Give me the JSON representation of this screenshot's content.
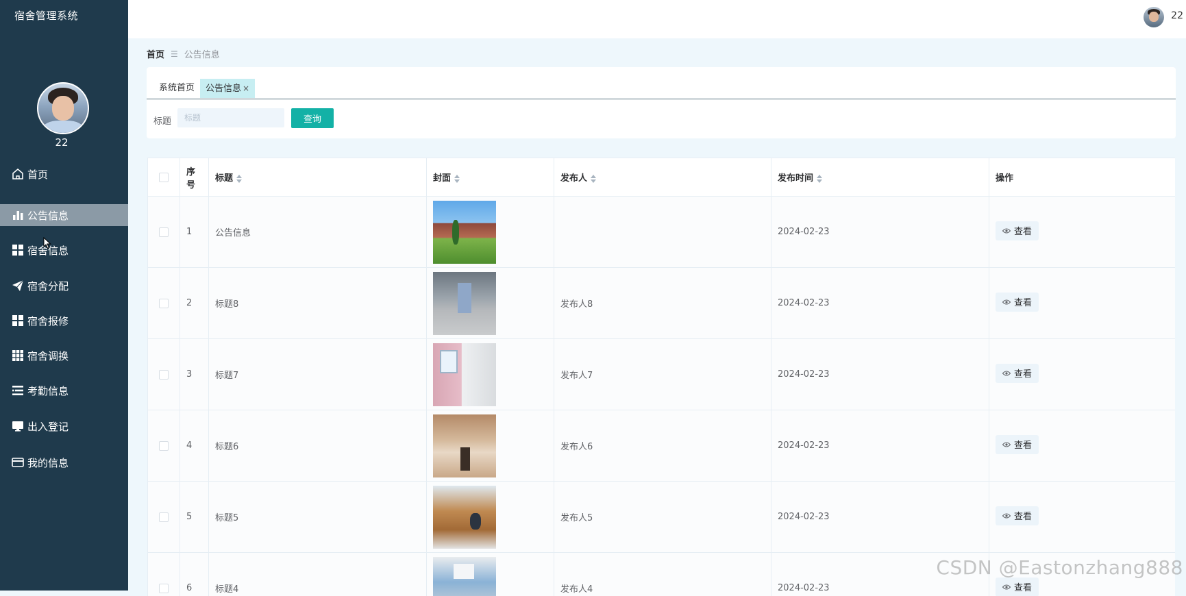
{
  "app": {
    "title": "宿舍管理系统"
  },
  "user": {
    "name": "22"
  },
  "sidebar": {
    "items": [
      {
        "label": "首页",
        "icon": "home-icon"
      },
      {
        "label": "公告信息",
        "icon": "bar-chart-icon"
      },
      {
        "label": "宿舍信息",
        "icon": "grid-icon"
      },
      {
        "label": "宿舍分配",
        "icon": "paper-plane-icon"
      },
      {
        "label": "宿舍报修",
        "icon": "grid-icon"
      },
      {
        "label": "宿舍调换",
        "icon": "apps-icon"
      },
      {
        "label": "考勤信息",
        "icon": "list-icon"
      },
      {
        "label": "出入登记",
        "icon": "monitor-icon"
      },
      {
        "label": "我的信息",
        "icon": "card-icon"
      }
    ],
    "active_index": 1
  },
  "breadcrumb": {
    "home": "首页",
    "current": "公告信息"
  },
  "tabs": [
    {
      "label": "系统首页"
    },
    {
      "label": "公告信息",
      "close": "×"
    }
  ],
  "search": {
    "label": "标题",
    "placeholder": "标题",
    "value": "",
    "button": "查询"
  },
  "table": {
    "columns": [
      "序号",
      "标题",
      "封面",
      "发布人",
      "发布时间",
      "操作"
    ],
    "rows": [
      {
        "index": "1",
        "title": "公告信息",
        "publisher": "",
        "date": "2024-02-23",
        "action": "查看"
      },
      {
        "index": "2",
        "title": "标题8",
        "publisher": "发布人8",
        "date": "2024-02-23",
        "action": "查看"
      },
      {
        "index": "3",
        "title": "标题7",
        "publisher": "发布人7",
        "date": "2024-02-23",
        "action": "查看"
      },
      {
        "index": "4",
        "title": "标题6",
        "publisher": "发布人6",
        "date": "2024-02-23",
        "action": "查看"
      },
      {
        "index": "5",
        "title": "标题5",
        "publisher": "发布人5",
        "date": "2024-02-23",
        "action": "查看"
      },
      {
        "index": "6",
        "title": "标题4",
        "publisher": "发布人4",
        "date": "2024-02-23",
        "action": "查看"
      }
    ]
  },
  "watermark": "CSDN @Eastonzhang888",
  "colors": {
    "sidebar_bg": "#1f3a4c",
    "sidebar_active": "#8b9aa6",
    "primary_button": "#13b1a6",
    "active_tab": "#c7eef2",
    "page_bg": "#eef7fc"
  }
}
